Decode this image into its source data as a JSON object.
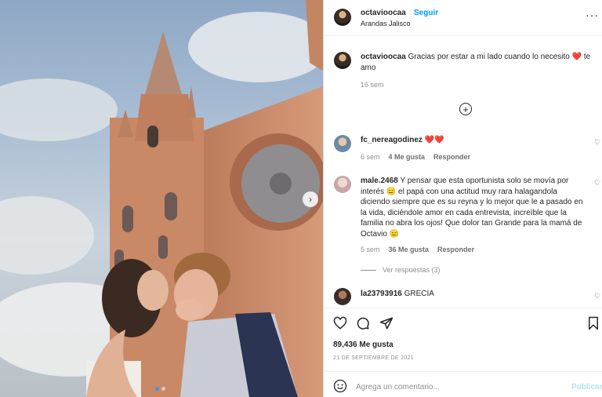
{
  "header": {
    "username": "octavioocaa",
    "follow_label": "Seguir",
    "location": "Arandas Jalisco",
    "more_label": "···"
  },
  "caption": {
    "username": "octavioocaa",
    "text": "Gracias por estar a mi lado cuando lo necesito",
    "emoji": "❤️",
    "text_end": "te amo",
    "time": "16 sem"
  },
  "load_more_label": "+",
  "comments": [
    {
      "username": "fc_nereagodinez",
      "text": "❤️❤️",
      "time": "6 sem",
      "likes": "4 Me gusta",
      "reply_label": "Responder"
    },
    {
      "username": "male.2468",
      "text": "Y pensar que esta oportunista solo se movía por interés 😑 el papá con una actitud muy rara halagandola diciendo siempre que es su reyna y lo mejor que le a pasado en la vida, diciéndole amor en cada entrevista, increíble que la familia no abra los ojos! Que dolor tan Grande para la mamá de Octavio 😑",
      "time": "5 sem",
      "likes": "36 Me gusta",
      "reply_label": "Responder",
      "view_replies": "Ver respuestas (3)"
    },
    {
      "username": "la23793916",
      "text": "GRECIA"
    }
  ],
  "footer": {
    "likes": "89,436 Me gusta",
    "date": "21 DE SEPTIEMBRE DE 2021",
    "comment_placeholder": "Agrega un comentario...",
    "post_label": "Publicar"
  },
  "colors": {
    "accent": "#0095f6",
    "heart": "#e0245e"
  }
}
